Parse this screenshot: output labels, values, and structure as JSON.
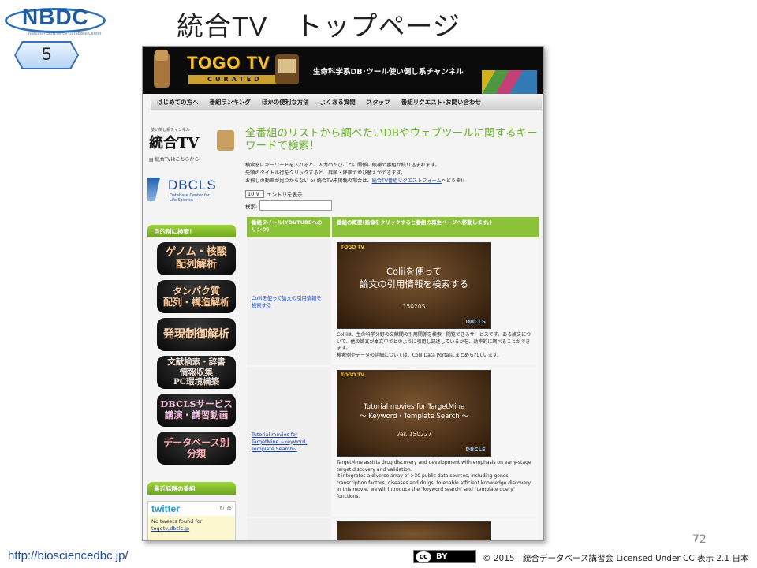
{
  "slide": {
    "logo_text": "NBDC",
    "logo_sub": "National Bioscience Database Center",
    "number": "5",
    "title": "統合TV　トップページ",
    "page_number": "72",
    "footer_url": "http://biosciencedbc.jp/",
    "license": "© 2015　統合データベース講習会 Licensed Under CC 表示 2.1 日本",
    "cc_badge": "BY"
  },
  "site": {
    "banner": {
      "logo": "TOGO TV",
      "curated": "CURATED",
      "tagline": "生命科学系DB･ツール使い倒し系チャンネル"
    },
    "nav": [
      "はじめての方へ",
      "番組ランキング",
      "ほかの便利な方法",
      "よくある質問",
      "スタッフ",
      "番組リクエスト･お問い合わせ"
    ],
    "sidebar": {
      "logo_small": "使い倒し系チャンネル",
      "logo_big": "統合TV",
      "link": "▤ 統合TVはこちらから!",
      "dbcls_title": "DBCLS",
      "dbcls_sub": "Database Center for Life Science",
      "purpose_heading": "目的別に検索！",
      "categories": [
        "ゲノム・核酸\n配列解析",
        "タンパク質\n配列・構造解析",
        "発現制御解析",
        "文献検索・辞書\n情報収集\nPC環境構築",
        "DBCLSサービス\n講演・講習動画",
        "データベース別\n分類"
      ],
      "recent_heading": "最近話題の番組",
      "twitter_label": "twitter",
      "twitter_ctrl": "↻ ⊗",
      "no_tweets": "No tweets found for",
      "twitter_handle": "togotv,dbcls.jp"
    },
    "main": {
      "title": "全番組のリストから調べたいDBやウェブツールに関するキーワードで検索！",
      "desc_1": "検索窓にキーワードを入れると、入力のたびごとに関係に候補の番組が絞り込まれます。",
      "desc_2": "先頭のタイトル行をクリックすると、昇順・降順で並び替えができます。",
      "desc_3": "お探しの動画が見つからない or 統合TV未掲載の場合は、",
      "desc_link": "統合TV番組リクエストフォーム",
      "desc_4": "へどうぞ!!",
      "entries_value": "10 ∨",
      "entries_label": "エントリを表示",
      "search_label": "検索:",
      "search_value": "",
      "col_title": "番組タイトル(YOUTUBEへのリンク)",
      "col_desc": "番組の概要(画像をクリックすると番組の再生ページへ移動します。)",
      "rows": [
        {
          "title": "Coliiを使って論文の引用情報を検索する",
          "thumb_title": "Coliiを使って\n論文の引用情報を検索する",
          "thumb_date": "15020S",
          "thumb_brand": "TOGO TV",
          "thumb_logo": "DBCLS",
          "desc": "Coliiは、生命科学分野の文献間の引用関係を検索・閲覧できるサービスです。ある論文について、他の論文が本文中でどのように引用し記述しているかを、効率的に調べることができます。\n検索例やデータの詳細については、Colil Data Portalにまとめられています。"
        },
        {
          "title": "Tutorial movies for TargetMine ~keyword, Template Search~",
          "thumb_title": "Tutorial movies for TargetMine\n～ Keyword・Template Search ～",
          "thumb_date": "ver. 150227",
          "thumb_brand": "TOGO TV",
          "thumb_logo": "DBCLS",
          "desc": "TargetMine assists drug discovery and development with emphasis on early-stage target discovery and validation.\nIt integrates a diverse array of >30 public data sources, including genes, transcription factors, diseases and drugs, to enable efficient knowledge discovery.\nIn this movie, we will introduce the \"keyword search\" and \"template query\" functions."
        }
      ]
    }
  }
}
